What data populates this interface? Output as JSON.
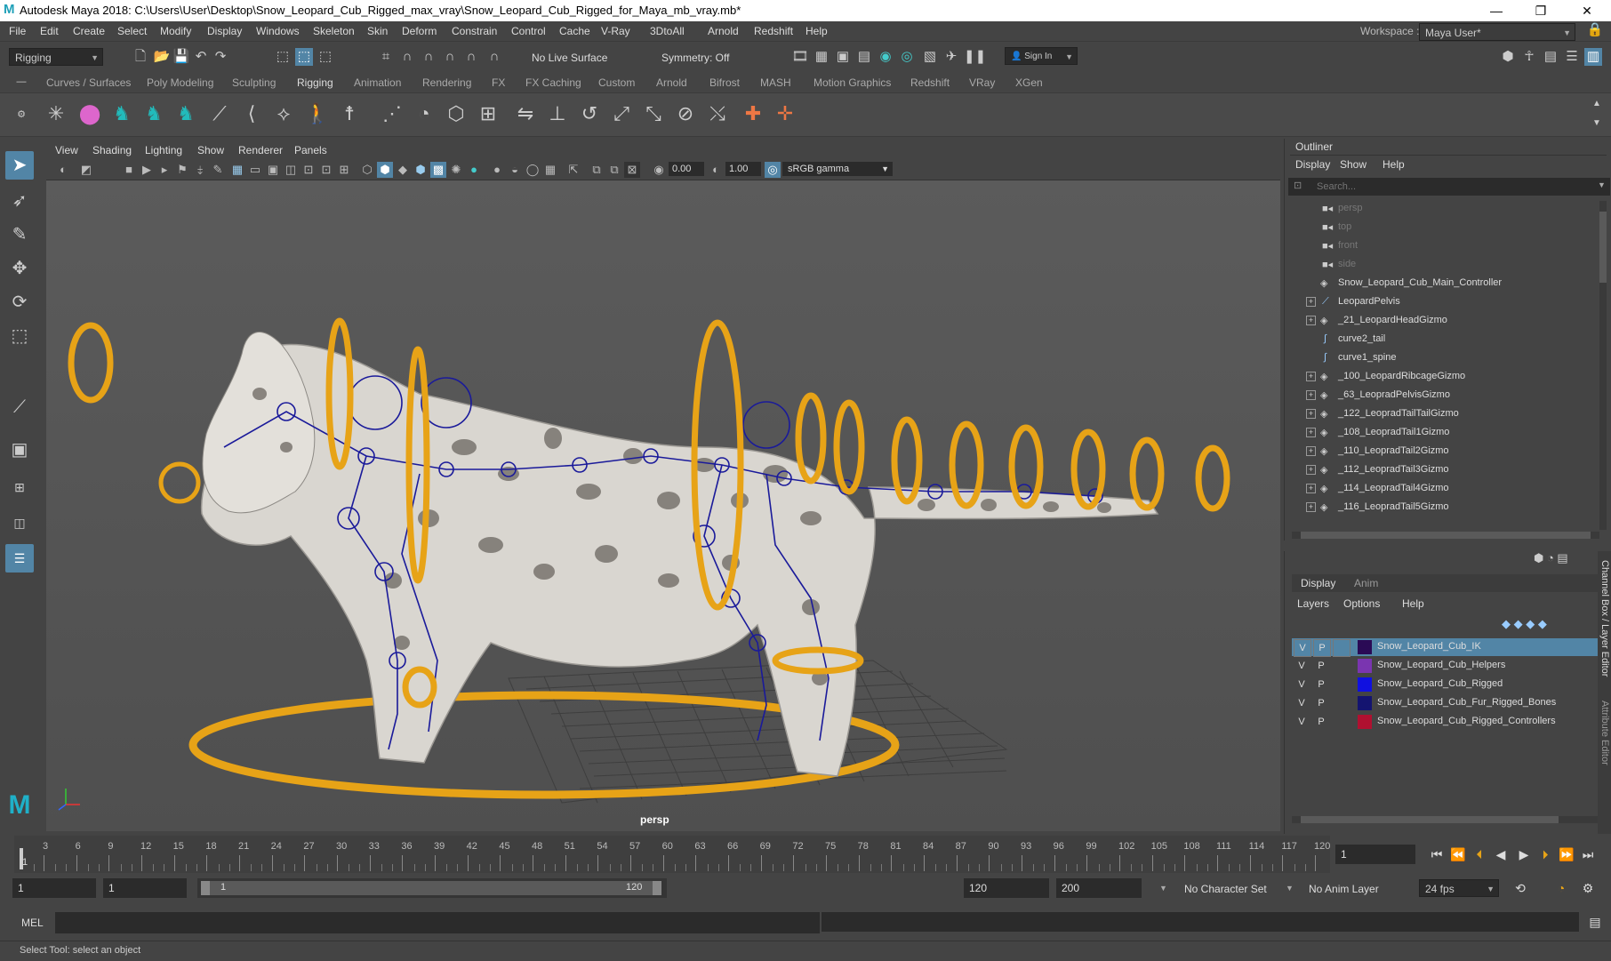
{
  "titlebar": {
    "title": "Autodesk Maya 2018: C:\\Users\\User\\Desktop\\Snow_Leopard_Cub_Rigged_max_vray\\Snow_Leopard_Cub_Rigged_for_Maya_mb_vray.mb*",
    "logo": "M",
    "min": "—",
    "max": "❐",
    "close": "✕"
  },
  "menubar": {
    "items": [
      "File",
      "Edit",
      "Create",
      "Select",
      "Modify",
      "Display",
      "Windows",
      "Skeleton",
      "Skin",
      "Deform",
      "Constrain",
      "Control",
      "Cache",
      "V-Ray",
      "3DtoAll",
      "Arnold",
      "Redshift",
      "Help"
    ],
    "workspace_label": "Workspace :",
    "workspace_value": "Maya User*"
  },
  "statusline": {
    "mode": "Rigging",
    "live_surface": "No Live Surface",
    "symmetry": "Symmetry: Off",
    "signin": "Sign In"
  },
  "shelf_tabs": [
    "Curves / Surfaces",
    "Poly Modeling",
    "Sculpting",
    "Rigging",
    "Animation",
    "Rendering",
    "FX",
    "FX Caching",
    "Custom",
    "Arnold",
    "Bifrost",
    "MASH",
    "Motion Graphics",
    "Redshift",
    "VRay",
    "XGen"
  ],
  "shelf_active": "Rigging",
  "viewport": {
    "menus": [
      "View",
      "Shading",
      "Lighting",
      "Show",
      "Renderer",
      "Panels"
    ],
    "exposure": "0.00",
    "gamma": "1.00",
    "colorspace": "sRGB gamma",
    "camera_label": "persp"
  },
  "outliner": {
    "title": "Outliner",
    "menus": [
      "Display",
      "Show",
      "Help"
    ],
    "search_placeholder": "Search...",
    "items": [
      {
        "label": "persp",
        "dim": true,
        "icon": "camera"
      },
      {
        "label": "top",
        "dim": true,
        "icon": "camera"
      },
      {
        "label": "front",
        "dim": true,
        "icon": "camera"
      },
      {
        "label": "side",
        "dim": true,
        "icon": "camera"
      },
      {
        "label": "Snow_Leopard_Cub_Main_Controller",
        "dim": false,
        "icon": "group"
      },
      {
        "label": "LeopardPelvis",
        "dim": false,
        "icon": "joint",
        "expand": true
      },
      {
        "label": "_21_LeopardHeadGizmo",
        "dim": false,
        "icon": "group",
        "expand": true
      },
      {
        "label": "curve2_tail",
        "dim": false,
        "icon": "curve"
      },
      {
        "label": "curve1_spine",
        "dim": false,
        "icon": "curve"
      },
      {
        "label": "_100_LeopardRibcageGizmo",
        "dim": false,
        "icon": "group",
        "expand": true
      },
      {
        "label": "_63_LeopradPelvisGizmo",
        "dim": false,
        "icon": "group",
        "expand": true
      },
      {
        "label": "_122_LeopradTailTailGizmo",
        "dim": false,
        "icon": "group",
        "expand": true
      },
      {
        "label": "_108_LeopradTail1Gizmo",
        "dim": false,
        "icon": "group",
        "expand": true
      },
      {
        "label": "_110_LeopradTail2Gizmo",
        "dim": false,
        "icon": "group",
        "expand": true
      },
      {
        "label": "_112_LeopradTail3Gizmo",
        "dim": false,
        "icon": "group",
        "expand": true
      },
      {
        "label": "_114_LeopradTail4Gizmo",
        "dim": false,
        "icon": "group",
        "expand": true
      },
      {
        "label": "_116_LeopradTail5Gizmo",
        "dim": false,
        "icon": "group",
        "expand": true
      }
    ]
  },
  "layers": {
    "tabs": [
      "Display",
      "Anim"
    ],
    "menus": [
      "Layers",
      "Options",
      "Help"
    ],
    "rows": [
      {
        "v": "V",
        "p": "P",
        "name": "Snow_Leopard_Cub_IK",
        "color": "#2a0a55",
        "selected": true
      },
      {
        "v": "V",
        "p": "P",
        "name": "Snow_Leopard_Cub_Helpers",
        "color": "#7a35b0",
        "selected": false
      },
      {
        "v": "V",
        "p": "P",
        "name": "Snow_Leopard_Cub_Rigged",
        "color": "#1010e0",
        "selected": false
      },
      {
        "v": "V",
        "p": "P",
        "name": "Snow_Leopard_Cub_Fur_Rigged_Bones",
        "color": "#141470",
        "selected": false
      },
      {
        "v": "V",
        "p": "P",
        "name": "Snow_Leopard_Cub_Rigged_Controllers",
        "color": "#b01030",
        "selected": false
      }
    ],
    "side_tabs": [
      "Channel Box / Layer Editor",
      "Attribute Editor"
    ]
  },
  "timeline": {
    "ticks": [
      "3",
      "6",
      "9",
      "12",
      "15",
      "18",
      "21",
      "24",
      "27",
      "30",
      "33",
      "36",
      "39",
      "42",
      "45",
      "48",
      "51",
      "54",
      "57",
      "60",
      "63",
      "66",
      "69",
      "72",
      "75",
      "78",
      "81",
      "84",
      "87",
      "90",
      "93",
      "96",
      "99",
      "102",
      "105",
      "108",
      "111",
      "114",
      "117",
      "120"
    ],
    "first_tick": "1",
    "current_frame": "1"
  },
  "range": {
    "start": "1",
    "playback_start": "1",
    "slider_start": "1",
    "slider_end": "120",
    "playback_end": "120",
    "end": "200",
    "character_set": "No Character Set",
    "anim_layer": "No Anim Layer",
    "fps": "24 fps"
  },
  "cmdline": {
    "label": "MEL"
  },
  "helpline": {
    "text": "Select Tool: select an object"
  },
  "colors": {
    "accent": "#5285a6",
    "gizmo": "#e7a317",
    "joint": "#1a1a9a"
  }
}
